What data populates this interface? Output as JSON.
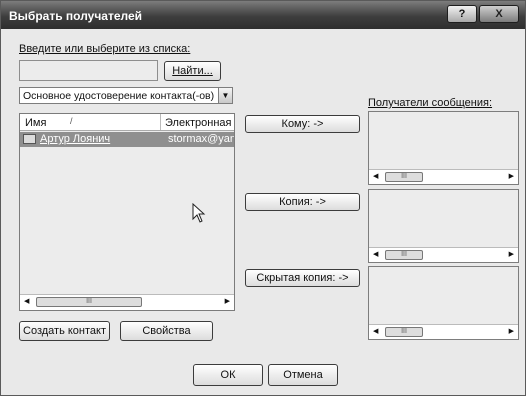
{
  "window": {
    "title": "Выбрать получателей",
    "help_label": "?",
    "close_label": "X"
  },
  "search": {
    "label": "Введите или выберите из списка:",
    "value": "",
    "find_button": "Найти..."
  },
  "address_book": {
    "selected": "Основное удостоверение контакта(-ов)"
  },
  "contacts_list": {
    "columns": [
      "Имя",
      "Электронная"
    ],
    "rows": [
      {
        "name": "Артур Лоянич",
        "email": "stormax@yand"
      }
    ]
  },
  "recipients": {
    "label": "Получатели сообщения:",
    "to_button": "Кому: ->",
    "cc_button": "Копия: ->",
    "bcc_button": "Скрытая копия: ->"
  },
  "actions": {
    "new_contact": "Создать контакт",
    "properties": "Свойства",
    "ok": "ОК",
    "cancel": "Отмена"
  },
  "icons": {
    "scroll_left": "scroll-left-icon",
    "scroll_right": "scroll-right-icon",
    "contact": "contact-card-icon",
    "dropdown": "chevron-down-icon",
    "cursor": "mouse-pointer-icon"
  }
}
